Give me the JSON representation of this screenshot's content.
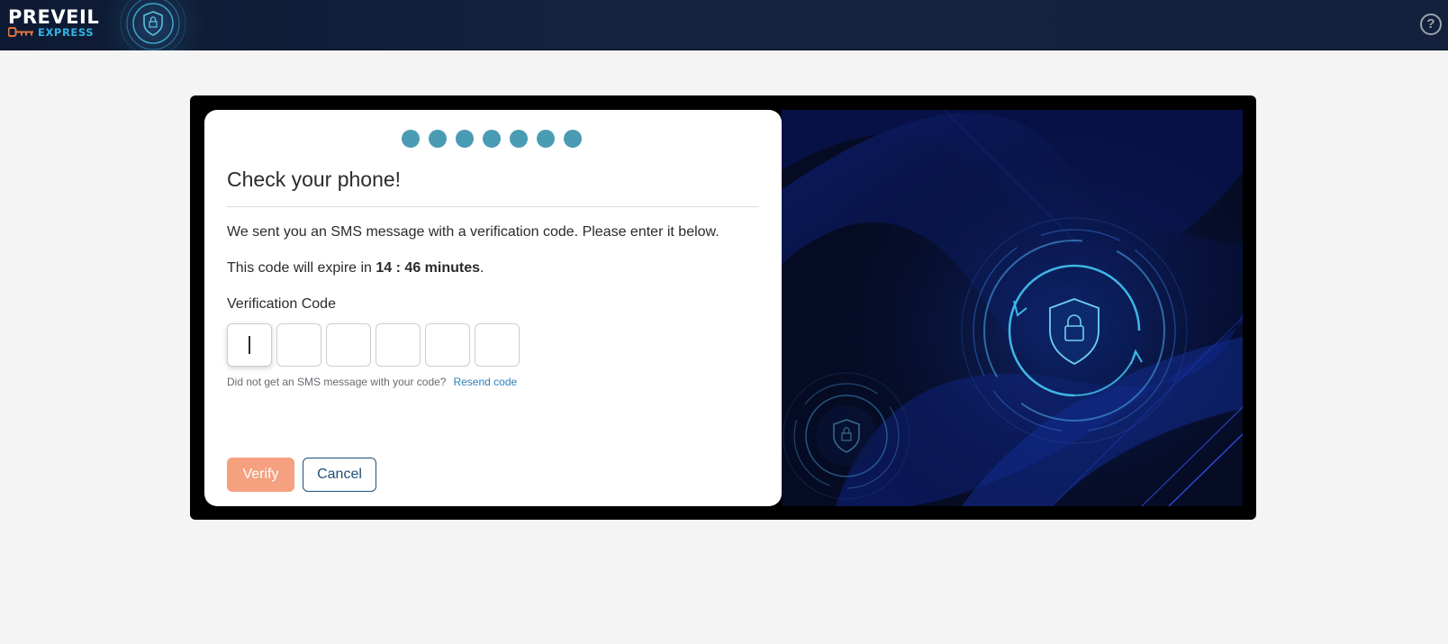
{
  "header": {
    "brand_name": "PREVEIL",
    "brand_sub": "EXPRESS",
    "help_label": "?"
  },
  "steps": {
    "count": 7,
    "color": "#4a9bb4"
  },
  "card": {
    "title": "Check your phone!",
    "message": "We sent you an SMS message with a verification code. Please enter it below.",
    "expire_prefix": "This code will expire in ",
    "expire_time": "14 : 46 minutes",
    "expire_suffix": ".",
    "code_label": "Verification Code",
    "code_digits": [
      "",
      "",
      "",
      "",
      "",
      ""
    ],
    "resend_prompt": "Did not get an SMS message with your code?",
    "resend_link": "Resend code",
    "verify_label": "Verify",
    "cancel_label": "Cancel"
  },
  "colors": {
    "header_bg": "#13213d",
    "accent_orange": "#f5a07e",
    "cancel_border": "#1f4e78",
    "link": "#2e7fb8",
    "logo_express": "#2fb4e6"
  },
  "icons": {
    "header_emblem": "shield-lock-icon",
    "help": "question-circle-icon",
    "art_main": "shield-lock-icon",
    "art_small": "shield-lock-icon"
  }
}
